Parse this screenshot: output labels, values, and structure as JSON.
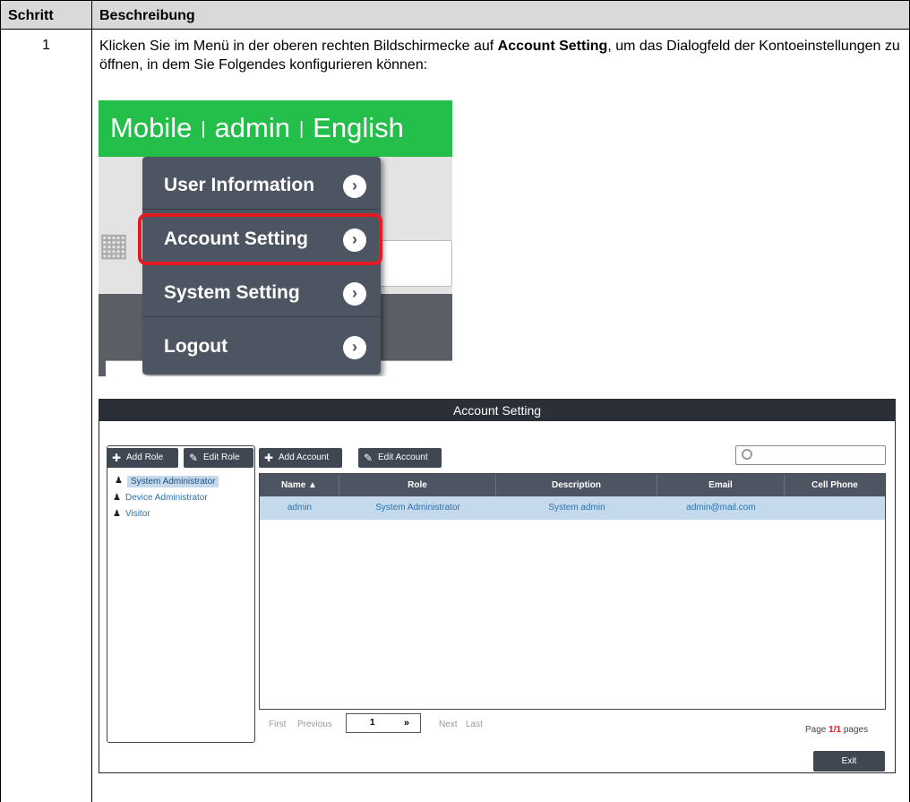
{
  "table": {
    "headers": {
      "step": "Schritt",
      "description": "Beschreibung"
    },
    "rows": [
      {
        "step": "1",
        "text_before": "Klicken Sie im Menü in der oberen rechten Bildschirmecke auf ",
        "text_bold": "Account Setting",
        "text_after": ", um das Dialogfeld der Kontoeinstellungen zu öffnen, in dem Sie Folgendes konfigurieren können:"
      }
    ]
  },
  "menu_screenshot": {
    "top_bar": {
      "item1": "Mobile",
      "separator": "|",
      "item2": "admin",
      "item3": "English"
    },
    "items": [
      {
        "label": "User Information"
      },
      {
        "label": "Account Setting",
        "highlighted": true
      },
      {
        "label": "System Setting"
      },
      {
        "label": "Logout"
      }
    ],
    "chevron_icon": "chevron-right-circle-icon",
    "highlight_color": "#e41b23",
    "top_bar_color": "#23bf4a",
    "menu_bg_color": "#4d5563"
  },
  "account_dialog": {
    "title": "Account Setting",
    "buttons": {
      "add_role": "Add Role",
      "edit_role": "Edit Role",
      "add_account": "Add Account",
      "edit_account": "Edit Account",
      "exit": "Exit"
    },
    "roles": [
      {
        "label": "System Administrator",
        "selected": true
      },
      {
        "label": "Device Administrator",
        "selected": false
      },
      {
        "label": "Visitor",
        "selected": false
      }
    ],
    "search": {
      "placeholder": ""
    },
    "columns": [
      "Name ▲",
      "Role",
      "Description",
      "Email",
      "Cell Phone"
    ],
    "rows": [
      {
        "name": "admin",
        "role": "System Administrator",
        "description": "System admin",
        "email": "admin@mail.com",
        "cell_phone": ""
      }
    ],
    "pager": {
      "first": "First",
      "previous": "Previous",
      "current_page": "1",
      "dropdown_icon": "double-chevron-down-icon",
      "next": "Next",
      "last": "Last",
      "page_prefix": "Page",
      "page_current": "1",
      "page_sep": "/",
      "page_total": "1",
      "page_suffix": "pages"
    },
    "header_bg_color": "#4d5563",
    "selected_row_color": "#c5d9ec",
    "link_color": "#2a73ac"
  }
}
